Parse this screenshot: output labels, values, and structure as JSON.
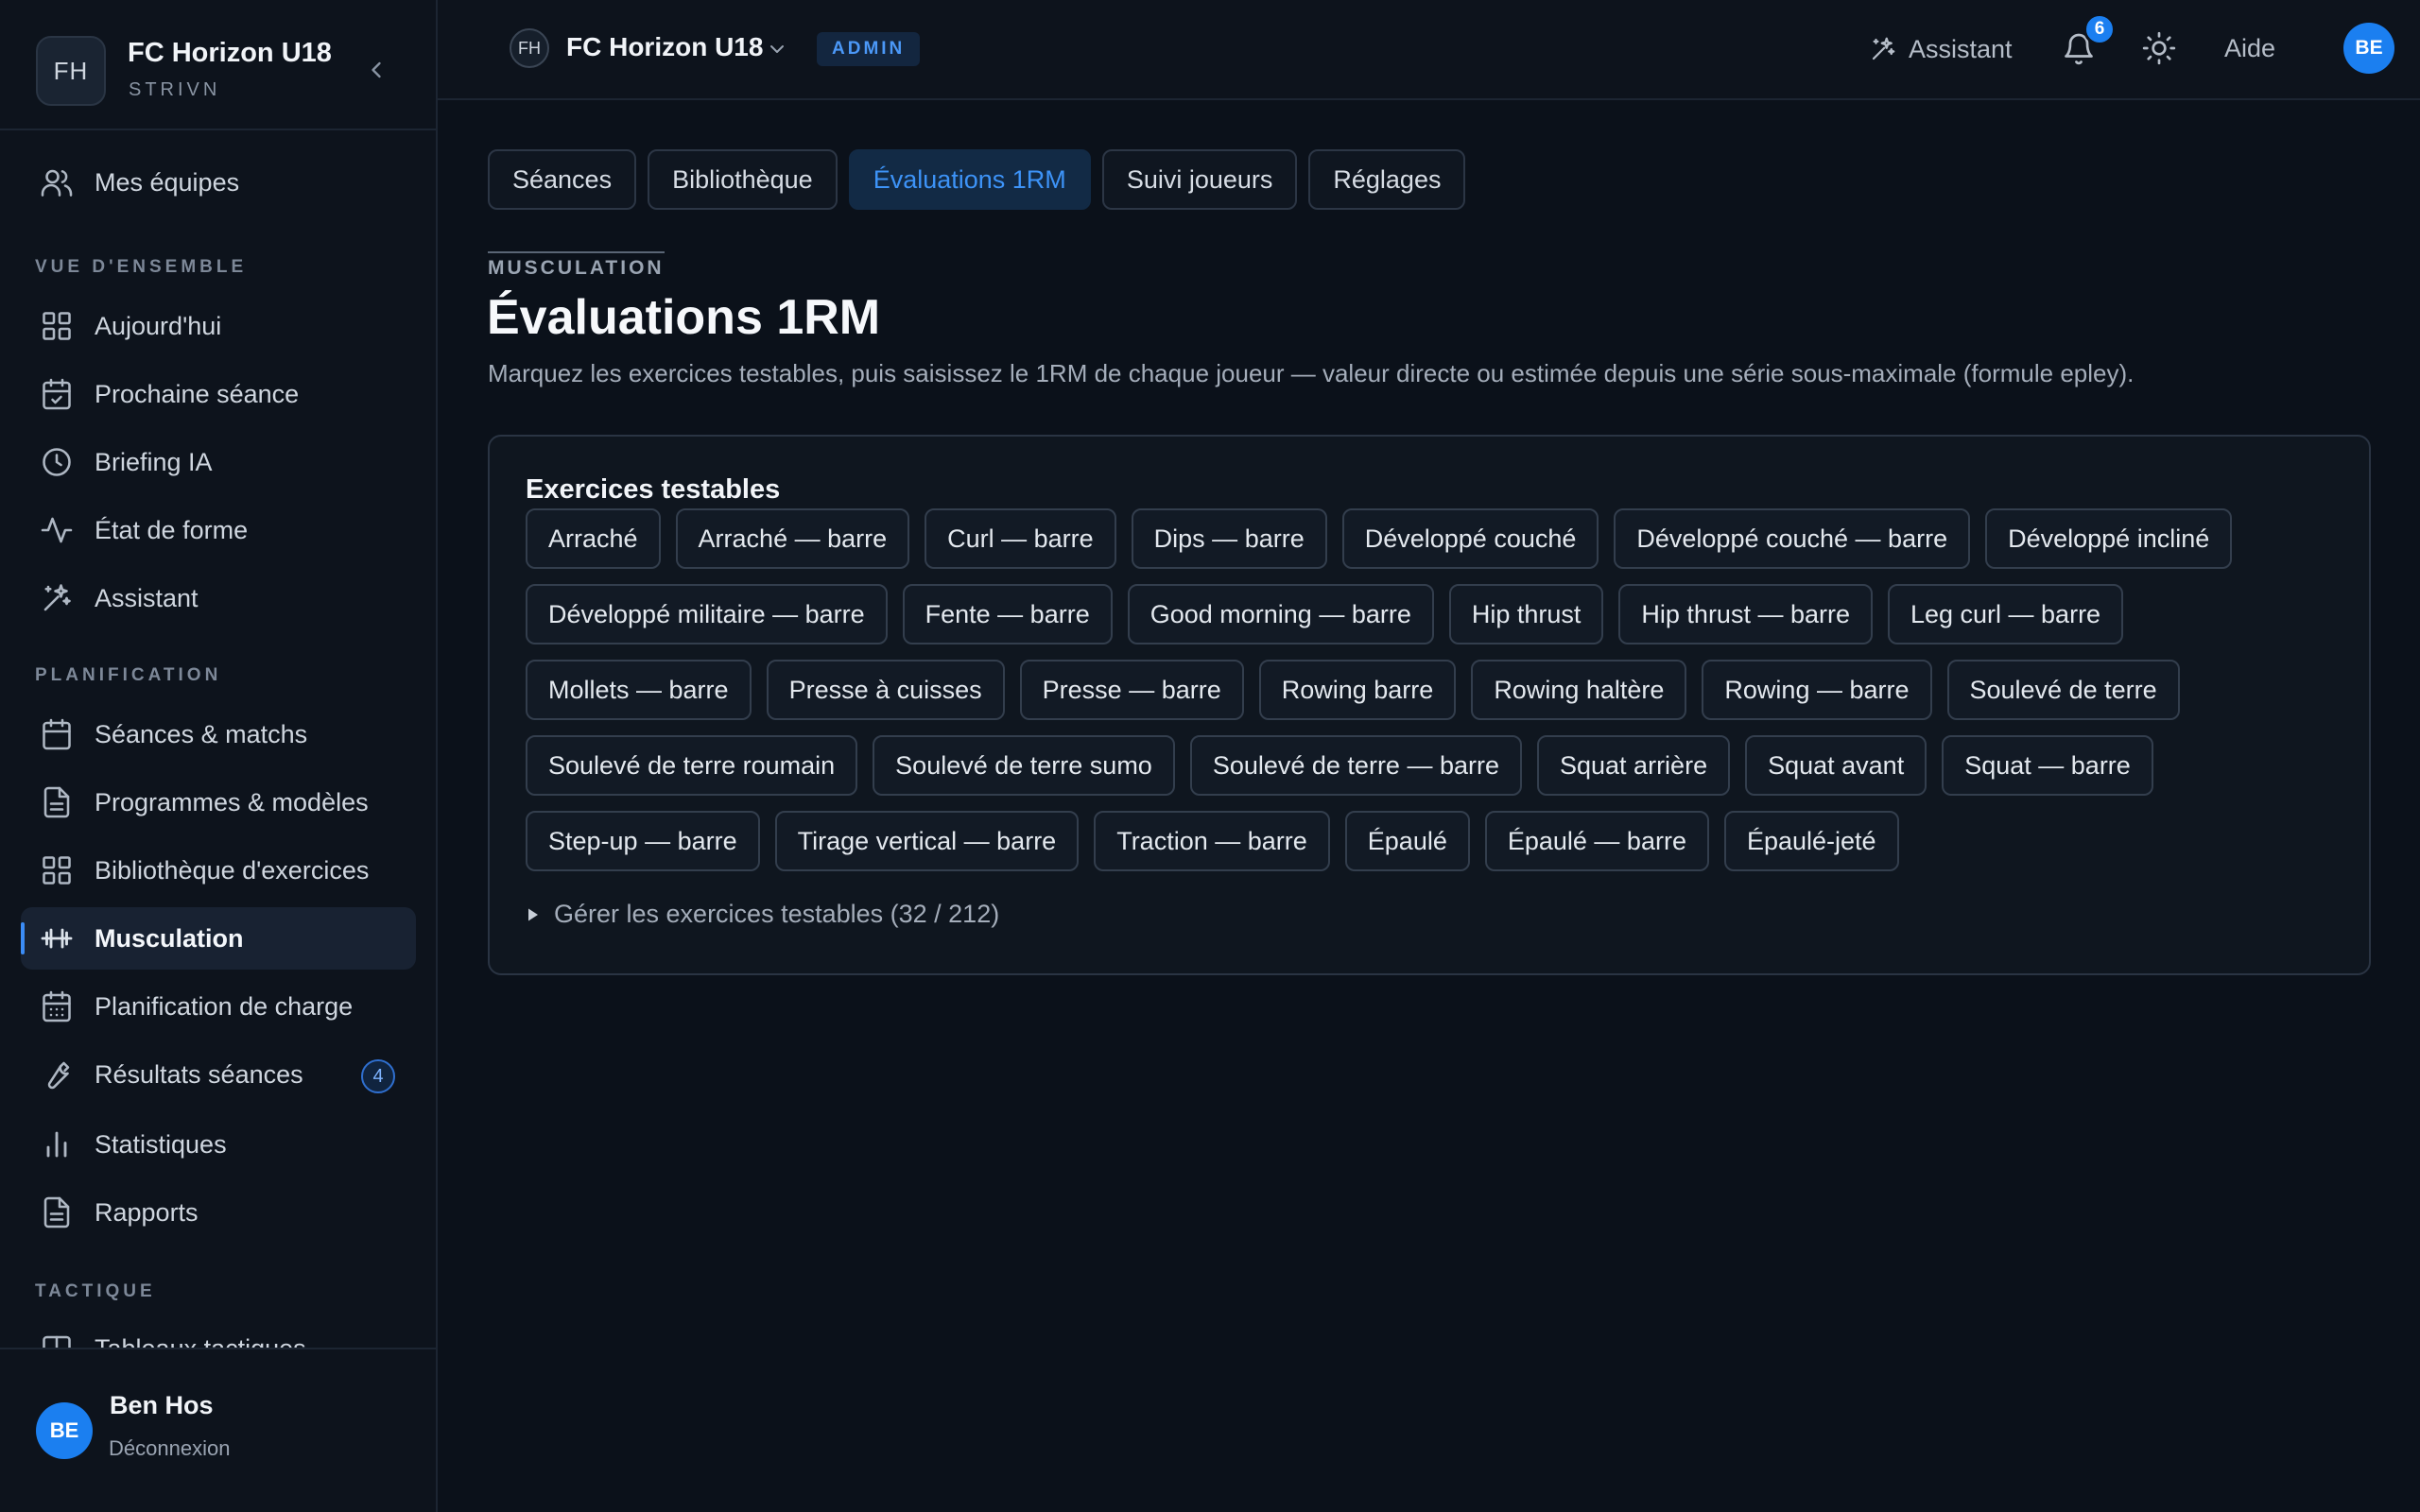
{
  "org": {
    "logo": "FH",
    "name": "FC Horizon U18",
    "sub": "STRIVN"
  },
  "sidebar": {
    "my_teams": "Mes équipes",
    "sections": {
      "overview": "VUE D'ENSEMBLE",
      "planning": "PLANIFICATION",
      "tactics": "TACTIQUE"
    },
    "items": [
      {
        "label": "Aujourd'hui",
        "icon": "grid-icon"
      },
      {
        "label": "Prochaine séance",
        "icon": "calendar-check-icon"
      },
      {
        "label": "Briefing IA",
        "icon": "clock-icon"
      },
      {
        "label": "État de forme",
        "icon": "activity-icon"
      },
      {
        "label": "Assistant",
        "icon": "sparkles-icon"
      },
      {
        "label": "Séances & matchs",
        "icon": "calendar-icon"
      },
      {
        "label": "Programmes & modèles",
        "icon": "document-icon"
      },
      {
        "label": "Bibliothèque d'exercices",
        "icon": "grid-icon"
      },
      {
        "label": "Musculation",
        "icon": "dumbbell-icon",
        "active": true
      },
      {
        "label": "Planification de charge",
        "icon": "calendar-grid-icon"
      },
      {
        "label": "Résultats séances",
        "icon": "wrench-icon",
        "badge": "4"
      },
      {
        "label": "Statistiques",
        "icon": "bar-chart-icon"
      },
      {
        "label": "Rapports",
        "icon": "document-icon"
      },
      {
        "label": "Tableaux tactiques",
        "icon": "board-icon"
      }
    ]
  },
  "user": {
    "initials": "BE",
    "name": "Ben Hos",
    "logout": "Déconnexion"
  },
  "topbar": {
    "team_chip": "FH",
    "team_name": "FC Horizon U18",
    "role": "ADMIN",
    "assistant": "Assistant",
    "notifications": "6",
    "help": "Aide",
    "avatar": "BE"
  },
  "tabs": [
    "Séances",
    "Bibliothèque",
    "Évaluations 1RM",
    "Suivi joueurs",
    "Réglages"
  ],
  "page": {
    "eyebrow": "MUSCULATION",
    "title": "Évaluations 1RM",
    "description": "Marquez les exercices testables, puis saisissez le 1RM de chaque joueur — valeur directe ou estimée depuis une série sous-maximale (formule epley)."
  },
  "testable": {
    "title": "Exercices testables",
    "exercises": [
      "Arraché",
      "Arraché — barre",
      "Curl — barre",
      "Dips — barre",
      "Développé couché",
      "Développé couché — barre",
      "Développé incliné",
      "Développé militaire — barre",
      "Fente — barre",
      "Good morning — barre",
      "Hip thrust",
      "Hip thrust — barre",
      "Leg curl — barre",
      "Mollets — barre",
      "Presse à cuisses",
      "Presse — barre",
      "Rowing barre",
      "Rowing haltère",
      "Rowing — barre",
      "Soulevé de terre",
      "Soulevé de terre roumain",
      "Soulevé de terre sumo",
      "Soulevé de terre — barre",
      "Squat arrière",
      "Squat avant",
      "Squat — barre",
      "Step-up — barre",
      "Tirage vertical — barre",
      "Traction — barre",
      "Épaulé",
      "Épaulé — barre",
      "Épaulé-jeté"
    ],
    "manage_label": "Gérer les exercices testables (32 / 212)"
  }
}
